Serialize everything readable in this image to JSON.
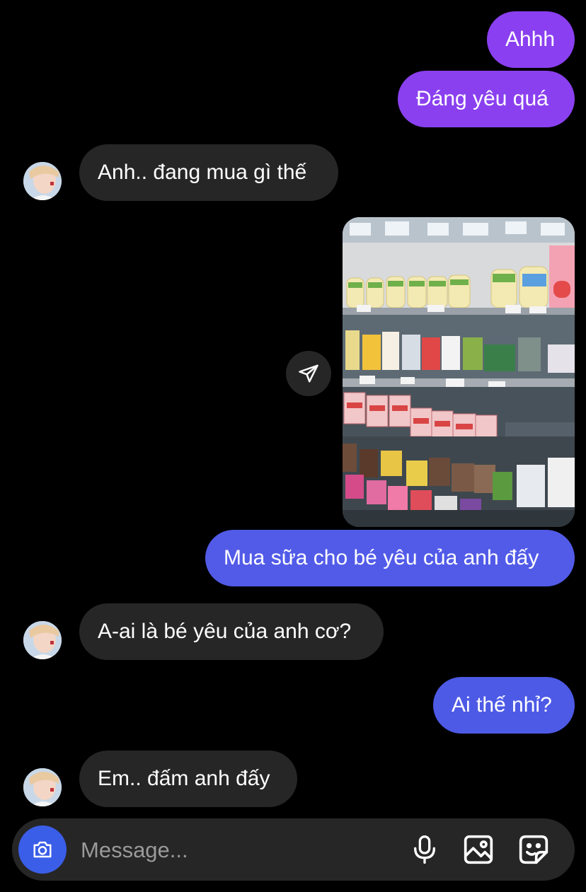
{
  "messages": [
    {
      "id": "m1",
      "sender": "me",
      "text": "Ahhh"
    },
    {
      "id": "m2",
      "sender": "me",
      "text": "Đáng yêu quá"
    },
    {
      "id": "m3",
      "sender": "them",
      "text": "Anh.. đang mua gì thế"
    },
    {
      "id": "m4",
      "sender": "me",
      "type": "photo",
      "icon": "milk-shelf-photo"
    },
    {
      "id": "m5",
      "sender": "me",
      "text": "Mua sữa cho bé yêu của anh đấy"
    },
    {
      "id": "m6",
      "sender": "them",
      "text": "A-ai là bé yêu của anh cơ?"
    },
    {
      "id": "m7",
      "sender": "me",
      "text": "Ai thế nhỉ?"
    },
    {
      "id": "m8",
      "sender": "them",
      "text": "Em.. đấm anh đấy"
    }
  ],
  "composer": {
    "placeholder": "Message...",
    "icons": [
      "camera-icon",
      "microphone-icon",
      "gallery-icon",
      "sticker-icon"
    ]
  },
  "colors": {
    "background": "#000000",
    "incoming_bubble": "#262626",
    "outgoing_top": "#8a3ff0",
    "outgoing_bottom": "#4d5ae6",
    "camera_button": "#3a5ee8"
  }
}
